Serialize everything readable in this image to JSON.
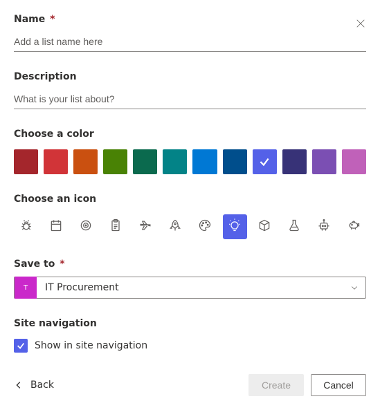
{
  "labels": {
    "name": "Name",
    "description": "Description",
    "choose_color": "Choose a color",
    "choose_icon": "Choose an icon",
    "save_to": "Save to",
    "site_navigation": "Site navigation",
    "required_mark": "*"
  },
  "name_input": {
    "value": "",
    "placeholder": "Add a list name here"
  },
  "description_input": {
    "value": "",
    "placeholder": "What is your list about?"
  },
  "colors": [
    {
      "name": "dark-red",
      "hex": "#a4262c",
      "selected": false
    },
    {
      "name": "red",
      "hex": "#d13438",
      "selected": false
    },
    {
      "name": "orange",
      "hex": "#ca5010",
      "selected": false
    },
    {
      "name": "green",
      "hex": "#498205",
      "selected": false
    },
    {
      "name": "dark-green",
      "hex": "#0b6a4e",
      "selected": false
    },
    {
      "name": "teal",
      "hex": "#038387",
      "selected": false
    },
    {
      "name": "blue",
      "hex": "#0078d4",
      "selected": false
    },
    {
      "name": "dark-blue",
      "hex": "#004e8c",
      "selected": false
    },
    {
      "name": "periwinkle",
      "hex": "#5461e8",
      "selected": true
    },
    {
      "name": "navy",
      "hex": "#373277",
      "selected": false
    },
    {
      "name": "purple",
      "hex": "#7b4fb3",
      "selected": false
    },
    {
      "name": "pink",
      "hex": "#c061b9",
      "selected": false
    }
  ],
  "icons": [
    {
      "name": "bug",
      "selected": false
    },
    {
      "name": "calendar",
      "selected": false
    },
    {
      "name": "target",
      "selected": false
    },
    {
      "name": "clipboard",
      "selected": false
    },
    {
      "name": "airplane",
      "selected": false
    },
    {
      "name": "rocket",
      "selected": false
    },
    {
      "name": "palette",
      "selected": false
    },
    {
      "name": "lightbulb",
      "selected": true
    },
    {
      "name": "cube",
      "selected": false
    },
    {
      "name": "beaker",
      "selected": false
    },
    {
      "name": "robot",
      "selected": false
    },
    {
      "name": "piggybank",
      "selected": false
    }
  ],
  "save_to": {
    "selected_label": "IT Procurement",
    "site_initial": "T",
    "site_color": "#ca28ca"
  },
  "show_in_nav": {
    "label": "Show in site navigation",
    "checked": true
  },
  "footer": {
    "back": "Back",
    "create": "Create",
    "cancel": "Cancel"
  }
}
